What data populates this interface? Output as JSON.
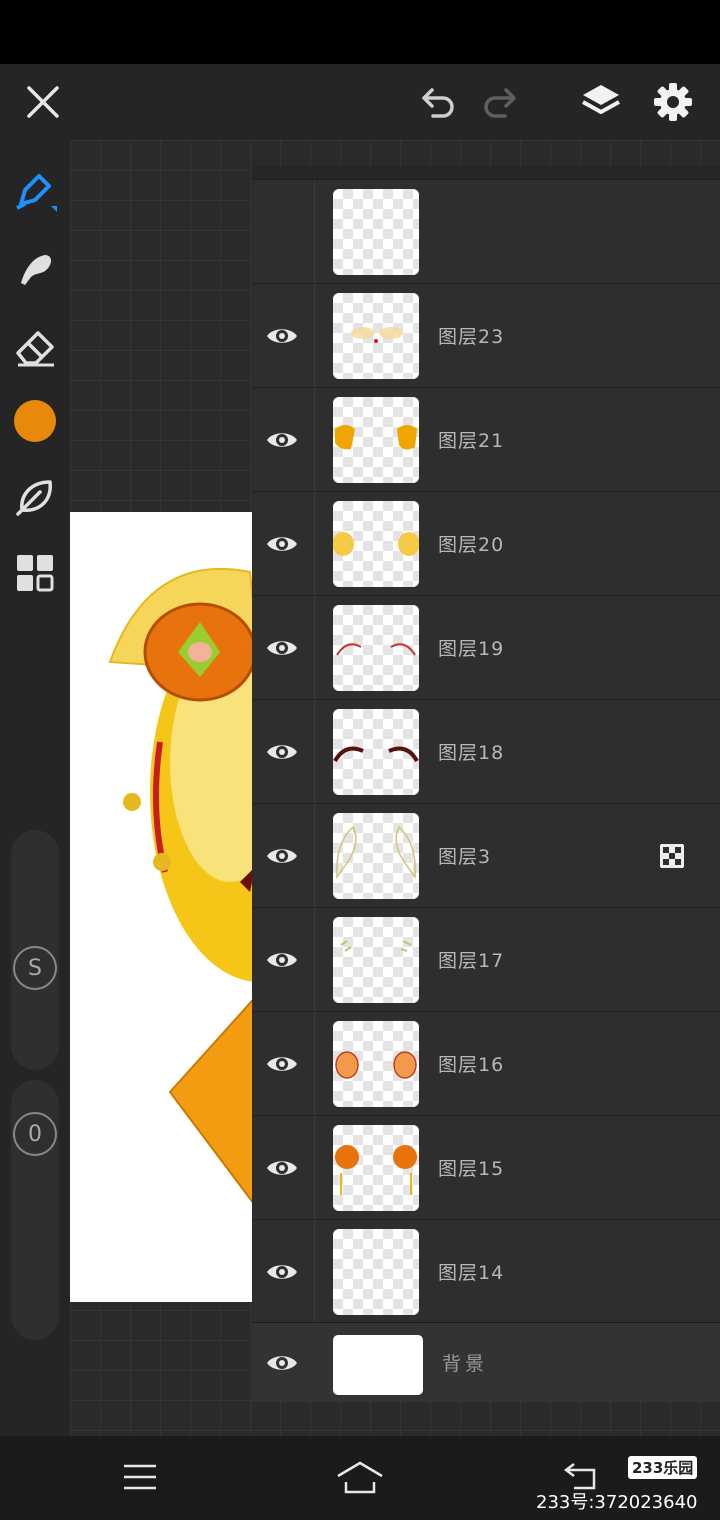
{
  "layers": [
    {
      "name": "",
      "thumb": "partial",
      "visible": true
    },
    {
      "name": "图层23",
      "thumb": "l23",
      "visible": true
    },
    {
      "name": "图层21",
      "thumb": "l21",
      "visible": true
    },
    {
      "name": "图层20",
      "thumb": "l20",
      "visible": true
    },
    {
      "name": "图层19",
      "thumb": "l19",
      "visible": true
    },
    {
      "name": "图层18",
      "thumb": "l18",
      "visible": true
    },
    {
      "name": "图层3",
      "thumb": "l3",
      "visible": true,
      "clipping_mask": true
    },
    {
      "name": "图层17",
      "thumb": "l17",
      "visible": true
    },
    {
      "name": "图层16",
      "thumb": "l16",
      "visible": true
    },
    {
      "name": "图层15",
      "thumb": "l15",
      "visible": true
    },
    {
      "name": "图层14",
      "thumb": "l14",
      "visible": true
    }
  ],
  "background_layer": {
    "name": "背景",
    "visible": true
  },
  "current_color": "#E8890C",
  "accent_color": "#1E90FF",
  "slider_size_label": "S",
  "slider_opacity_label": "0",
  "watermark": {
    "logo": "233乐园",
    "id_text": "233号:372023640"
  },
  "icons": {
    "topbar": [
      "close-icon",
      "undo-icon",
      "redo-icon",
      "layers-icon",
      "settings-icon"
    ],
    "layer_panel": [
      "add-icon",
      "folder-icon",
      "lock-icon",
      "merge-down-icon",
      "alpha-lock-icon",
      "blend-icon"
    ],
    "tools": [
      "pen-icon",
      "smudge-icon",
      "eraser-icon",
      "color-swatch",
      "leaf-brush-icon",
      "grid-icon"
    ],
    "navbar": [
      "menu-icon",
      "home-icon",
      "back-icon"
    ]
  }
}
